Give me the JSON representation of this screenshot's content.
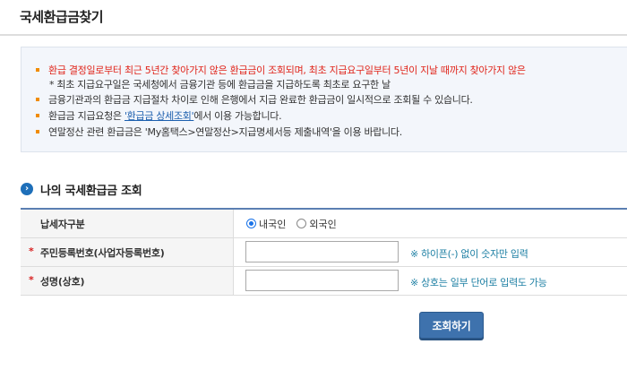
{
  "header": {
    "title": "국세환급금찾기"
  },
  "notice": {
    "line1": "환급 결정일로부터 최근 5년간 찾아가지 않은 환급금이 조회되며, 최초 지급요구일부터 5년이 지날 때까지 찾아가지 않은",
    "line2": "* 최초 지급요구일은 국세청에서 금융기관 등에 환급금을 지급하도록 최초로 요구한 날",
    "line3": "금융기관과의 환급금 지급절차 차이로 인해 은행에서 지급 완료한 환급금이 일시적으로 조회될 수 있습니다.",
    "line4_prefix": "환급금 지급요청은 ",
    "line4_link": "'환급금 상세조회'",
    "line4_suffix": "에서 이용 가능합니다.",
    "line5": "연말정산 관련 환급금은 'My홈택스>연말정산>지급명세서등 제출내역'을 이용 바랍니다."
  },
  "section": {
    "title": "나의 국세환급금 조회",
    "icon": "arrow-circle-icon"
  },
  "form": {
    "taxpayer_type": {
      "label": "납세자구분",
      "options": [
        {
          "label": "내국인",
          "checked": true
        },
        {
          "label": "외국인",
          "checked": false
        }
      ]
    },
    "id_number": {
      "required_mark": "*",
      "label": "주민등록번호(사업자등록번호)",
      "value": "",
      "placeholder": "",
      "hint": "※ 하이픈(-) 없이 숫자만 입력"
    },
    "name": {
      "required_mark": "*",
      "label": "성명(상호)",
      "value": "",
      "placeholder": "",
      "hint": "※ 상호는 일부 단어로 입력도 가능"
    }
  },
  "actions": {
    "submit_label": "조회하기"
  },
  "colors": {
    "accent": "#3e72ad",
    "warning_text": "#e0251b",
    "hint_text": "#1d7fa3",
    "bullet": "#f08c00",
    "notice_bg": "#f3f6fb"
  }
}
